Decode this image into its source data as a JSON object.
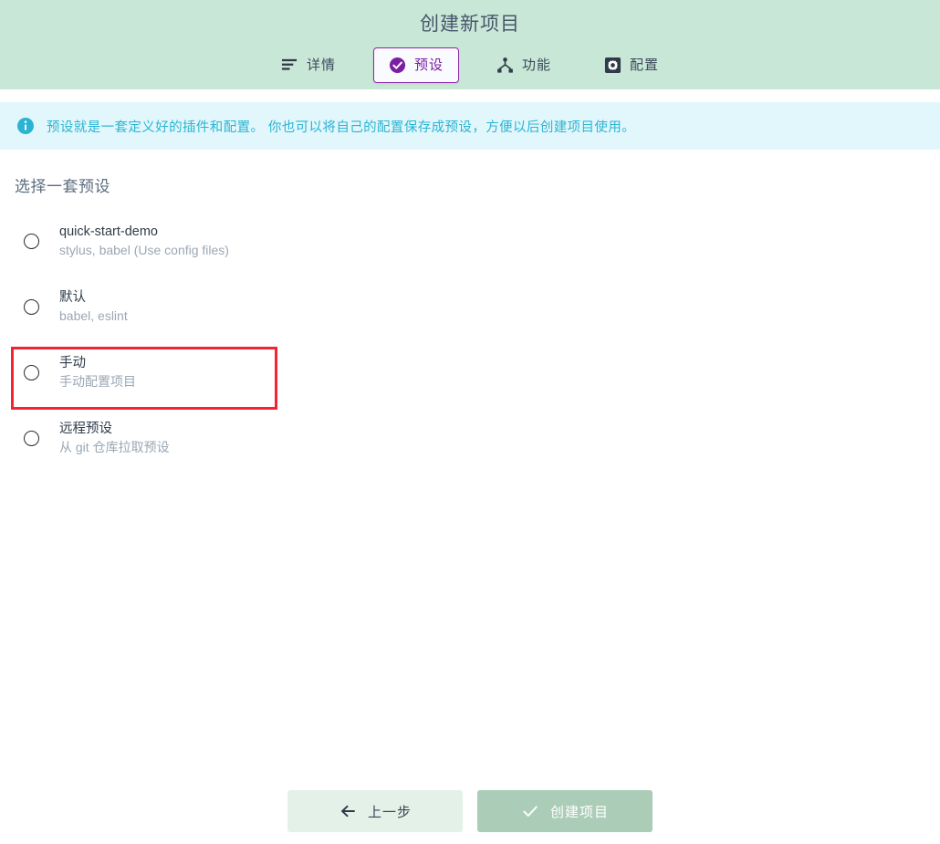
{
  "header": {
    "title": "创建新项目",
    "tabs": [
      {
        "label": "详情",
        "icon": "list-lines-icon",
        "active": false
      },
      {
        "label": "预设",
        "icon": "check-circle-icon",
        "active": true
      },
      {
        "label": "功能",
        "icon": "share-nodes-icon",
        "active": false
      },
      {
        "label": "配置",
        "icon": "gear-icon",
        "active": false
      }
    ]
  },
  "banner": {
    "icon": "info-circle-icon",
    "text": "预设就是一套定义好的插件和配置。 你也可以将自己的配置保存成预设，方便以后创建项目使用。"
  },
  "main": {
    "section_title": "选择一套预设",
    "options": [
      {
        "title": "quick-start-demo",
        "subtitle": "stylus, babel (Use config files)",
        "selected": false,
        "highlighted": true
      },
      {
        "title": "默认",
        "subtitle": "babel, eslint",
        "selected": false,
        "highlighted": false
      },
      {
        "title": "手动",
        "subtitle": "手动配置项目",
        "selected": false,
        "highlighted": false
      },
      {
        "title": "远程预设",
        "subtitle": "从 git 仓库拉取预设",
        "selected": false,
        "highlighted": false
      }
    ]
  },
  "footer": {
    "back_label": "上一步",
    "back_icon": "arrow-left-icon",
    "create_label": "创建项目",
    "create_icon": "check-icon",
    "create_disabled": true
  },
  "colors": {
    "header_bg": "#c9e7d6",
    "accent_purple": "#8e24aa",
    "banner_bg": "#e2f7fb",
    "banner_text": "#2ab4d4",
    "highlight_red": "#f4232f",
    "btn_back_bg": "#e3f1e8",
    "btn_create_bg": "#abcdb8"
  }
}
